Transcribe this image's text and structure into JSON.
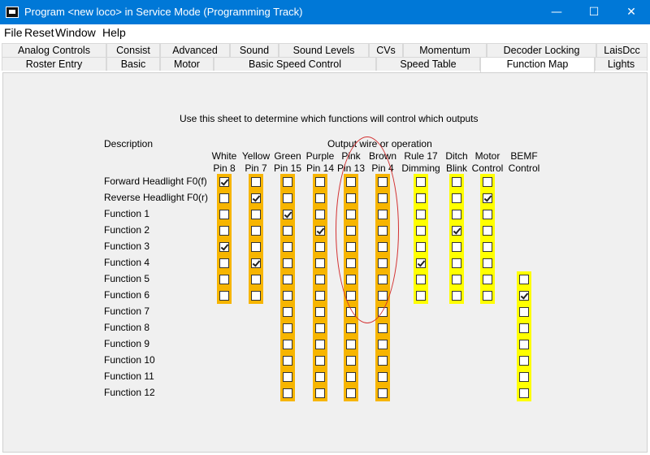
{
  "window": {
    "title": "Program <new loco> in Service Mode (Programming Track)",
    "controls": [
      "—",
      "☐",
      "✕"
    ]
  },
  "menu": [
    "File",
    "Reset",
    "Window",
    "Help"
  ],
  "tabs_row1": [
    "Analog Controls",
    "Consist",
    "Advanced",
    "Sound",
    "Sound Levels",
    "CVs",
    "Momentum",
    "Decoder Locking",
    "LaisDcc"
  ],
  "tabs_row2": [
    "Roster Entry",
    "Basic",
    "Motor",
    "Basic Speed Control",
    "Speed Table",
    "Function Map",
    "Lights"
  ],
  "active_tab": "Function Map",
  "sheet": {
    "instruction": "Use this sheet to determine which functions will control which outputs",
    "description_header": "Description",
    "output_header": "Output wire or operation",
    "columns": [
      {
        "line1": "White",
        "line2": "Pin 8",
        "color": "#f7b500"
      },
      {
        "line1": "Yellow",
        "line2": "Pin 7",
        "color": "#f7b500"
      },
      {
        "line1": "Green",
        "line2": "Pin 15",
        "color": "#f7b500"
      },
      {
        "line1": "Purple",
        "line2": "Pin 14",
        "color": "#f7b500"
      },
      {
        "line1": "Pink",
        "line2": "Pin 13",
        "color": "#f7b500"
      },
      {
        "line1": "Brown",
        "line2": "Pin 4",
        "color": "#f7b500"
      },
      {
        "line1": "Rule 17",
        "line2": "Dimming",
        "color": "#ffff00"
      },
      {
        "line1": "Ditch",
        "line2": "Blink",
        "color": "#ffff00"
      },
      {
        "line1": "Motor",
        "line2": "Control",
        "color": "#ffff00"
      },
      {
        "line1": "BEMF",
        "line2": "Control",
        "color": "#ffff00"
      }
    ],
    "rows": [
      {
        "label": "Forward Headlight F0(f)",
        "cells": [
          true,
          false,
          false,
          false,
          false,
          false,
          false,
          false,
          false,
          null
        ]
      },
      {
        "label": "Reverse Headlight F0(r)",
        "cells": [
          false,
          true,
          false,
          false,
          false,
          false,
          false,
          false,
          true,
          null
        ]
      },
      {
        "label": "Function 1",
        "cells": [
          false,
          false,
          true,
          false,
          false,
          false,
          false,
          false,
          false,
          null
        ]
      },
      {
        "label": "Function 2",
        "cells": [
          false,
          false,
          false,
          true,
          false,
          false,
          false,
          true,
          false,
          null
        ]
      },
      {
        "label": "Function 3",
        "cells": [
          true,
          false,
          false,
          false,
          false,
          false,
          false,
          false,
          false,
          null
        ]
      },
      {
        "label": "Function 4",
        "cells": [
          false,
          true,
          false,
          false,
          false,
          false,
          true,
          false,
          false,
          null
        ]
      },
      {
        "label": "Function 5",
        "cells": [
          false,
          false,
          false,
          false,
          false,
          false,
          false,
          false,
          false,
          false
        ]
      },
      {
        "label": "Function 6",
        "cells": [
          false,
          false,
          false,
          false,
          false,
          false,
          false,
          false,
          false,
          true
        ]
      },
      {
        "label": "Function 7",
        "cells": [
          null,
          null,
          false,
          false,
          false,
          false,
          null,
          null,
          null,
          false
        ]
      },
      {
        "label": "Function 8",
        "cells": [
          null,
          null,
          false,
          false,
          false,
          false,
          null,
          null,
          null,
          false
        ]
      },
      {
        "label": "Function 9",
        "cells": [
          null,
          null,
          false,
          false,
          false,
          false,
          null,
          null,
          null,
          false
        ]
      },
      {
        "label": "Function 10",
        "cells": [
          null,
          null,
          false,
          false,
          false,
          false,
          null,
          null,
          null,
          false
        ]
      },
      {
        "label": "Function 11",
        "cells": [
          null,
          null,
          false,
          false,
          false,
          false,
          null,
          null,
          null,
          false
        ]
      },
      {
        "label": "Function 12",
        "cells": [
          null,
          null,
          false,
          false,
          false,
          false,
          null,
          null,
          null,
          false
        ]
      }
    ]
  }
}
